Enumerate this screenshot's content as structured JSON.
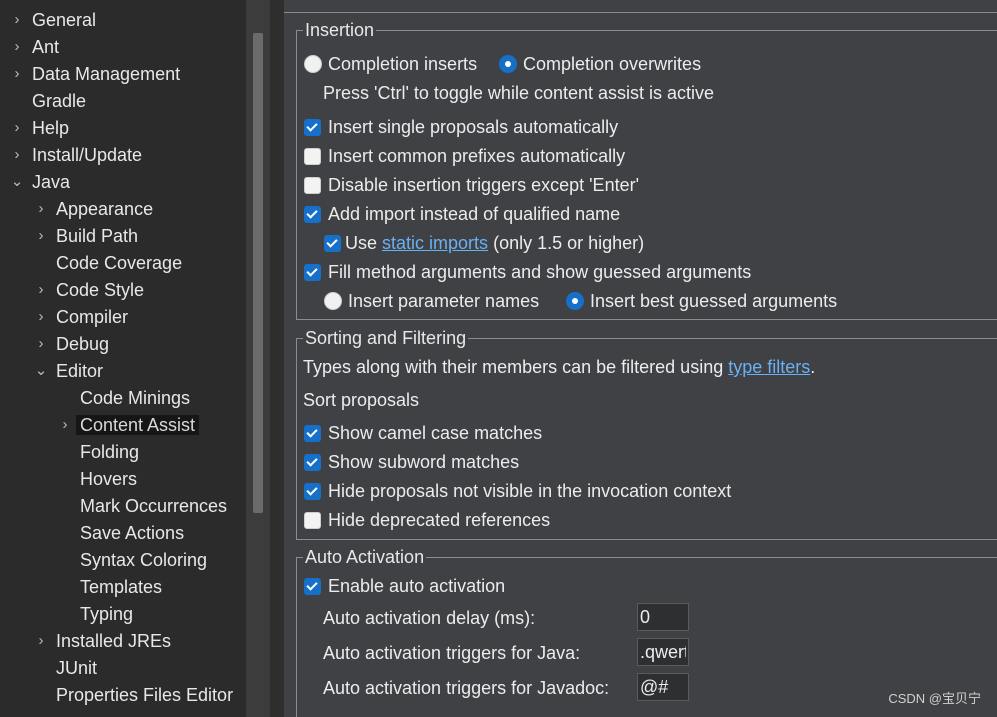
{
  "tree": {
    "items": [
      {
        "label": "General",
        "expander": "›"
      },
      {
        "label": "Ant",
        "expander": "›"
      },
      {
        "label": "Data Management",
        "expander": "›"
      },
      {
        "label": "Gradle",
        "expander": ""
      },
      {
        "label": "Help",
        "expander": "›"
      },
      {
        "label": "Install/Update",
        "expander": "›"
      },
      {
        "label": "Java",
        "expander": "⌄"
      },
      {
        "label": "Appearance",
        "expander": "›"
      },
      {
        "label": "Build Path",
        "expander": "›"
      },
      {
        "label": "Code Coverage",
        "expander": ""
      },
      {
        "label": "Code Style",
        "expander": "›"
      },
      {
        "label": "Compiler",
        "expander": "›"
      },
      {
        "label": "Debug",
        "expander": "›"
      },
      {
        "label": "Editor",
        "expander": "⌄"
      },
      {
        "label": "Code Minings",
        "expander": ""
      },
      {
        "label": "Content Assist",
        "expander": "›"
      },
      {
        "label": "Folding",
        "expander": ""
      },
      {
        "label": "Hovers",
        "expander": ""
      },
      {
        "label": "Mark Occurrences",
        "expander": ""
      },
      {
        "label": "Save Actions",
        "expander": ""
      },
      {
        "label": "Syntax Coloring",
        "expander": ""
      },
      {
        "label": "Templates",
        "expander": ""
      },
      {
        "label": "Typing",
        "expander": ""
      },
      {
        "label": "Installed JREs",
        "expander": "›"
      },
      {
        "label": "JUnit",
        "expander": ""
      },
      {
        "label": "Properties Files Editor",
        "expander": ""
      }
    ],
    "selected": "Content Assist"
  },
  "insertion": {
    "title": "Insertion",
    "radio_inserts": "Completion inserts",
    "radio_overwrites": "Completion overwrites",
    "toggle_hint": "Press 'Ctrl' to toggle while content assist is active",
    "insert_single": "Insert single proposals automatically",
    "insert_prefixes": "Insert common prefixes automatically",
    "disable_triggers": "Disable insertion triggers except 'Enter'",
    "add_import": "Add import instead of qualified name",
    "use_label": "Use",
    "static_imports_link": "static imports",
    "static_imports_suffix": "(only 1.5 or higher)",
    "fill_args": "Fill method arguments and show guessed arguments",
    "radio_param_names": "Insert parameter names",
    "radio_best_guessed": "Insert best guessed arguments"
  },
  "sorting": {
    "title": "Sorting and Filtering",
    "types_text": "Types along with their members can be filtered using",
    "type_filters_link": "type filters",
    "types_suffix": ".",
    "sort_proposals": "Sort proposals",
    "camel_case": "Show camel case matches",
    "subword": "Show subword matches",
    "hide_not_visible": "Hide proposals not visible in the invocation context",
    "hide_deprecated": "Hide deprecated references"
  },
  "auto_activation": {
    "title": "Auto Activation",
    "enable": "Enable auto activation",
    "delay_label": "Auto activation delay (ms):",
    "delay_value": "0",
    "java_label": "Auto activation triggers for Java:",
    "java_value": ".qwertyuiopasdfghjklzxcvbnm",
    "javadoc_label": "Auto activation triggers for Javadoc:",
    "javadoc_value": "@#"
  },
  "watermark": "CSDN @宝贝宁",
  "colors": {
    "accent": "#1670c9",
    "link": "#6ab0f2",
    "panel": "#3f4144",
    "tree": "#2b2b2b"
  }
}
